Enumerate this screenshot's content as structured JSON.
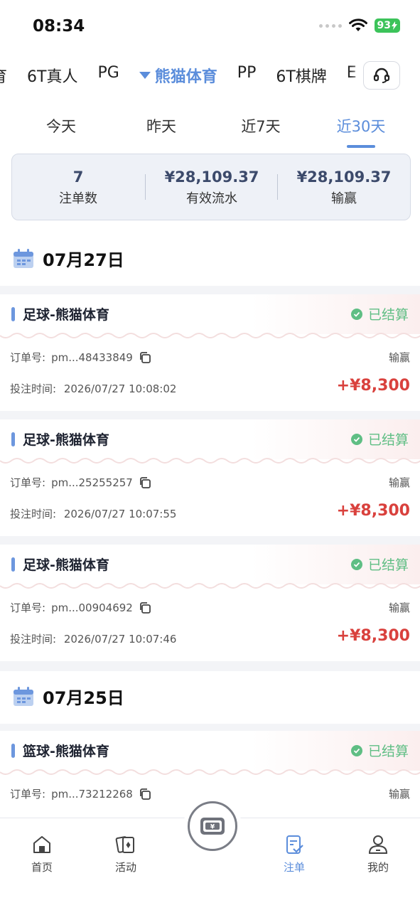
{
  "status_bar": {
    "time": "08:34",
    "battery": "93"
  },
  "providers": {
    "items": [
      "育",
      "6T真人",
      "PG",
      "熊猫体育",
      "PP",
      "6T棋牌",
      "E"
    ],
    "active_index": 3
  },
  "date_tabs": {
    "items": [
      "今天",
      "昨天",
      "近7天",
      "近30天"
    ],
    "active_index": 3
  },
  "summary": {
    "count_value": "7",
    "count_label": "注单数",
    "turnover_value": "¥28,109.37",
    "turnover_label": "有效流水",
    "winloss_value": "¥28,109.37",
    "winloss_label": "输赢"
  },
  "groups": [
    {
      "date": "07月27日",
      "orders": [
        {
          "title": "足球-熊猫体育",
          "status": "已结算",
          "order_label": "订单号:",
          "order_no": "pm...48433849",
          "result_label": "输赢",
          "time_label": "投注时间:",
          "time": "2026/07/27 10:08:02",
          "amount": "+¥8,300"
        },
        {
          "title": "足球-熊猫体育",
          "status": "已结算",
          "order_label": "订单号:",
          "order_no": "pm...25255257",
          "result_label": "输赢",
          "time_label": "投注时间:",
          "time": "2026/07/27 10:07:55",
          "amount": "+¥8,300"
        },
        {
          "title": "足球-熊猫体育",
          "status": "已结算",
          "order_label": "订单号:",
          "order_no": "pm...00904692",
          "result_label": "输赢",
          "time_label": "投注时间:",
          "time": "2026/07/27 10:07:46",
          "amount": "+¥8,300"
        }
      ]
    },
    {
      "date": "07月25日",
      "orders": [
        {
          "title": "篮球-熊猫体育",
          "status": "已结算",
          "order_label": "订单号:",
          "order_no": "pm...73212268",
          "result_label": "输赢"
        }
      ]
    }
  ],
  "bottom_nav": {
    "items": [
      {
        "label": "首页",
        "icon": "home-icon"
      },
      {
        "label": "活动",
        "icon": "cards-icon"
      },
      {
        "label": "",
        "icon": "wallet-yen-icon"
      },
      {
        "label": "注单",
        "icon": "betslip-icon"
      },
      {
        "label": "我的",
        "icon": "profile-icon"
      }
    ],
    "active_index": 3
  },
  "colors": {
    "accent": "#5b8ddb",
    "success": "#5fbe84",
    "win": "#d9413d"
  }
}
